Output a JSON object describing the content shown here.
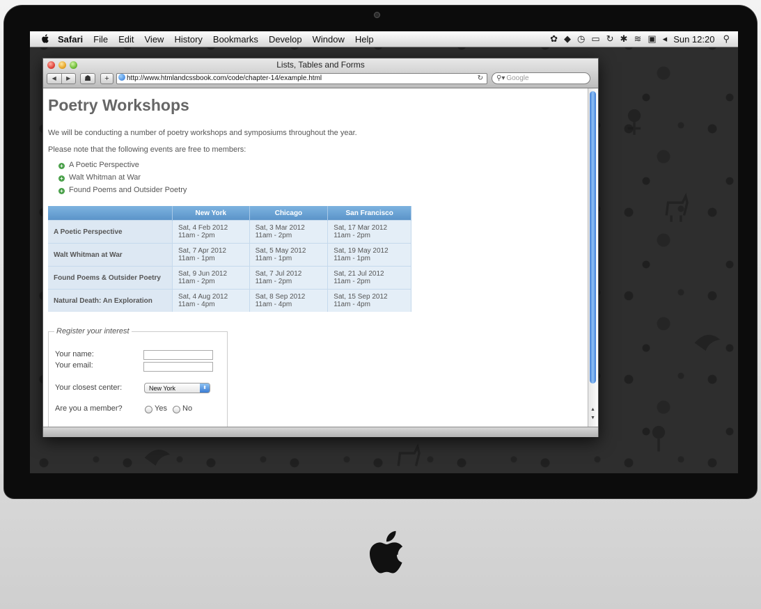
{
  "menubar": {
    "items": [
      "Safari",
      "File",
      "Edit",
      "View",
      "History",
      "Bookmarks",
      "Develop",
      "Window",
      "Help"
    ],
    "clock": "Sun 12:20"
  },
  "browser": {
    "window_title": "Lists, Tables and Forms",
    "url": "http://www.htmlandcssbook.com/code/chapter-14/example.html",
    "search_placeholder": "Google"
  },
  "page": {
    "heading": "Poetry Workshops",
    "intro": "We will be conducting a number of poetry workshops and symposiums throughout the year.",
    "note": "Please note that the following events are free to members:",
    "events": [
      "A Poetic Perspective",
      "Walt Whitman at War",
      "Found Poems and Outsider Poetry"
    ]
  },
  "table": {
    "headers": [
      "",
      "New York",
      "Chicago",
      "San Francisco"
    ],
    "rows": [
      {
        "name": "A Poetic Perspective",
        "cells": [
          [
            "Sat, 4 Feb 2012",
            "11am - 2pm"
          ],
          [
            "Sat, 3 Mar 2012",
            "11am - 2pm"
          ],
          [
            "Sat, 17 Mar 2012",
            "11am - 2pm"
          ]
        ]
      },
      {
        "name": "Walt Whitman at War",
        "cells": [
          [
            "Sat, 7 Apr 2012",
            "11am - 1pm"
          ],
          [
            "Sat, 5 May 2012",
            "11am - 1pm"
          ],
          [
            "Sat, 19 May 2012",
            "11am - 1pm"
          ]
        ]
      },
      {
        "name": "Found Poems & Outsider Poetry",
        "cells": [
          [
            "Sat, 9 Jun 2012",
            "11am - 2pm"
          ],
          [
            "Sat, 7 Jul 2012",
            "11am - 2pm"
          ],
          [
            "Sat, 21 Jul 2012",
            "11am - 2pm"
          ]
        ]
      },
      {
        "name": "Natural Death: An Exploration",
        "cells": [
          [
            "Sat, 4 Aug 2012",
            "11am - 4pm"
          ],
          [
            "Sat, 8 Sep 2012",
            "11am - 4pm"
          ],
          [
            "Sat, 15 Sep 2012",
            "11am - 4pm"
          ]
        ]
      }
    ]
  },
  "form": {
    "legend": "Register your interest",
    "name_label": "Your name:",
    "email_label": "Your email:",
    "center_label": "Your closest center:",
    "center_value": "New York",
    "member_label": "Are you a member?",
    "yes": "Yes",
    "no": "No"
  }
}
